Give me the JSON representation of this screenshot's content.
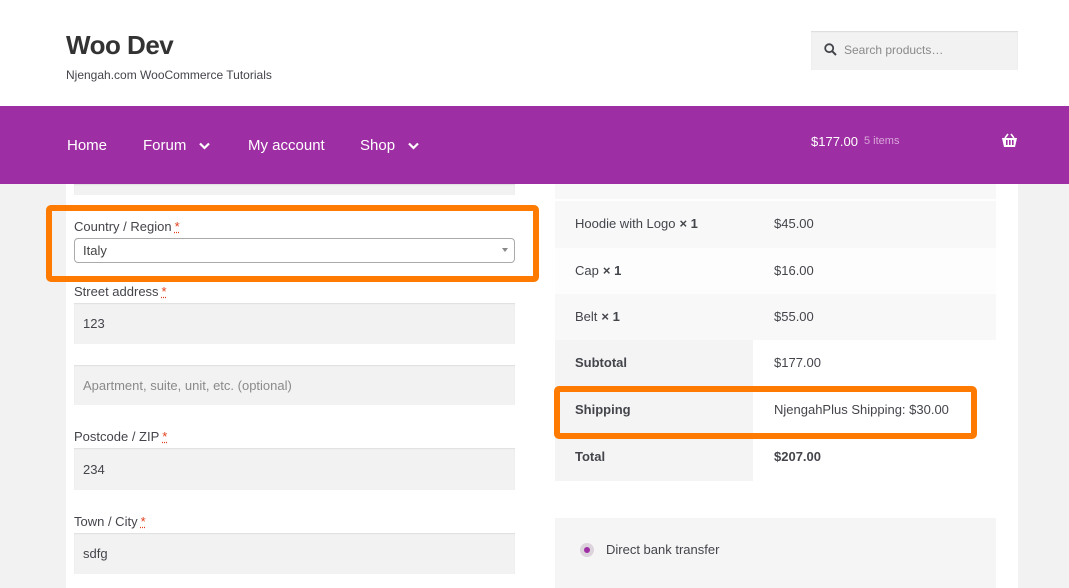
{
  "site": {
    "title": "Woo Dev",
    "tagline": "Njengah.com WooCommerce Tutorials"
  },
  "search": {
    "placeholder": "Search products…",
    "icon": "search-icon"
  },
  "nav": {
    "items": [
      {
        "label": "Home",
        "has_dropdown": false
      },
      {
        "label": "Forum",
        "has_dropdown": true
      },
      {
        "label": "My account",
        "has_dropdown": false
      },
      {
        "label": "Shop",
        "has_dropdown": true
      }
    ],
    "cart_total": "$177.00",
    "cart_count": "5 items",
    "cart_icon": "basket-icon"
  },
  "form": {
    "country": {
      "label": "Country / Region",
      "required": "*",
      "value": "Italy"
    },
    "street": {
      "label": "Street address",
      "required": "*",
      "value": "123",
      "placeholder2": "Apartment, suite, unit, etc. (optional)"
    },
    "postcode": {
      "label": "Postcode / ZIP",
      "required": "*",
      "value": "234"
    },
    "city": {
      "label": "Town / City",
      "required": "*",
      "value": "sdfg"
    }
  },
  "order": {
    "items": [
      {
        "name": "Hoodie with Logo",
        "qty": "× 1",
        "price": "$45.00"
      },
      {
        "name": "Cap",
        "qty": "× 1",
        "price": "$16.00"
      },
      {
        "name": "Belt",
        "qty": "× 1",
        "price": "$55.00"
      }
    ],
    "subtotal": {
      "label": "Subtotal",
      "value": "$177.00"
    },
    "shipping": {
      "label": "Shipping",
      "value": "NjengahPlus Shipping: $30.00"
    },
    "total": {
      "label": "Total",
      "value": "$207.00"
    }
  },
  "payment": {
    "method": "Direct bank transfer",
    "selected": true
  },
  "colors": {
    "nav_bg": "#9e2ea3",
    "highlight": "#ff7a00",
    "required": "#e2401c"
  }
}
